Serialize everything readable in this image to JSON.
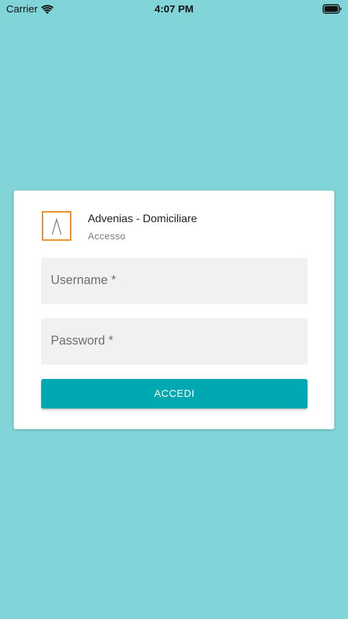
{
  "status_bar": {
    "carrier": "Carrier",
    "time": "4:07 PM",
    "wifi_icon": "wifi-icon",
    "battery_icon": "battery-icon"
  },
  "colors": {
    "background": "#81d5d8",
    "card": "#ffffff",
    "accent": "#00a9b2",
    "logo_border": "#f08a1c",
    "field_fill": "#f1f1f1"
  },
  "login_card": {
    "logo_icon": "advenias-logo-icon",
    "title": "Advenias - Domiciliare",
    "subtitle": "Accesso",
    "username": {
      "label": "Username *",
      "value": ""
    },
    "password": {
      "label": "Password *",
      "value": ""
    },
    "submit_label": "ACCEDI"
  }
}
